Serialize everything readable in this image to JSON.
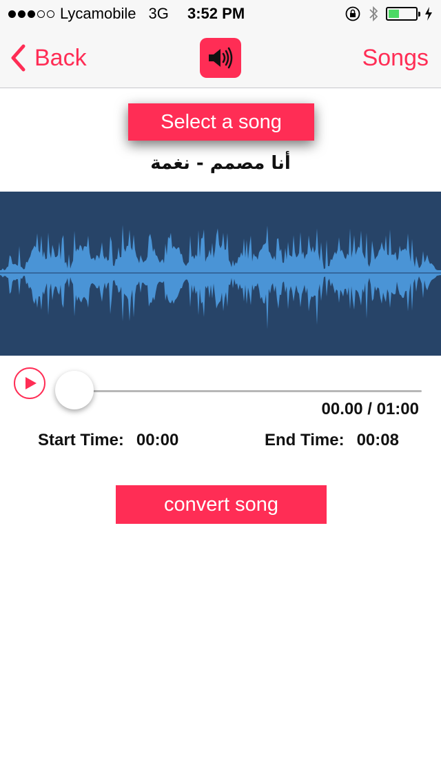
{
  "status_bar": {
    "signal_dots": [
      true,
      true,
      true,
      false,
      false
    ],
    "carrier": "Lycamobile",
    "network": "3G",
    "time": "3:52 PM",
    "icons": [
      "rotation-lock-icon",
      "bluetooth-icon",
      "battery-icon",
      "charging-icon"
    ],
    "battery_level": 0.35
  },
  "nav": {
    "back_label": "Back",
    "center_icon": "speaker-icon",
    "songs_label": "Songs"
  },
  "select_button": "Select a song",
  "song_title": "أنا مصمم - نغمة",
  "player": {
    "play_icon": "play-icon",
    "progress": 0.0,
    "time_display": "00.00 / 01:00",
    "start_label": "Start Time:",
    "start_value": "00:00",
    "end_label": "End Time:",
    "end_value": "00:08"
  },
  "convert_button": "convert song",
  "colors": {
    "accent": "#ff2d55",
    "waveform_bg": "#274468",
    "waveform": "#4a94d6",
    "battery": "#4cd964"
  }
}
